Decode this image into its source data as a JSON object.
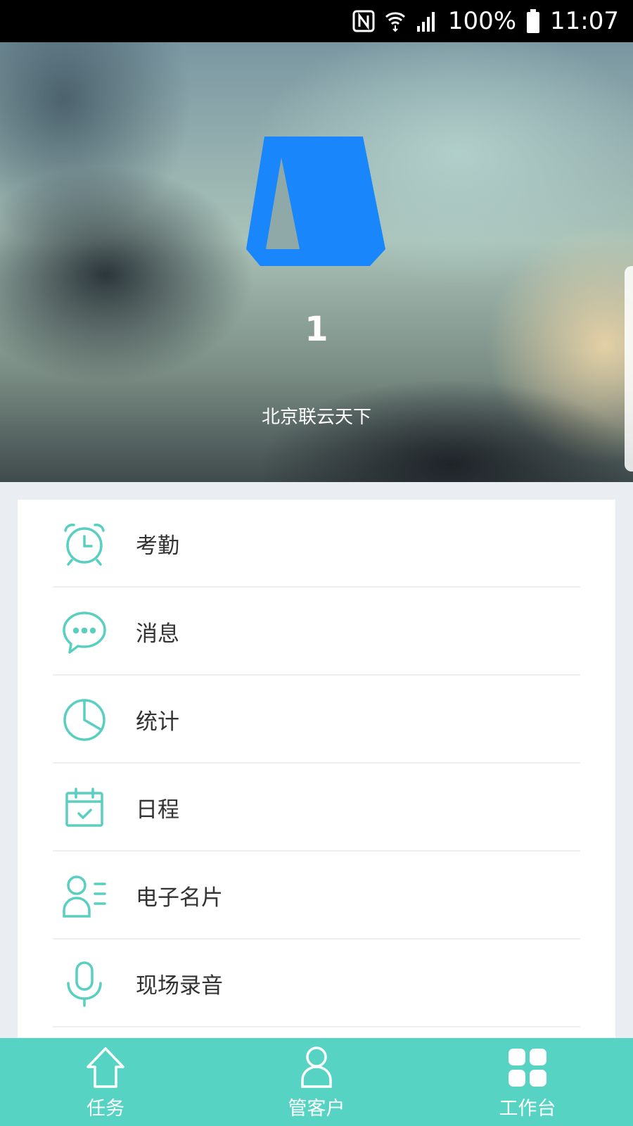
{
  "status_bar": {
    "battery": "100%",
    "time": "11:07",
    "icons": [
      "nfc-icon",
      "wifi-icon",
      "signal-icon",
      "battery-icon"
    ]
  },
  "profile": {
    "number": "1",
    "company": "北京联云天下",
    "logo_color": "#1a86fb"
  },
  "menu": {
    "items": [
      {
        "label": "考勤",
        "icon": "alarm-clock-icon"
      },
      {
        "label": "消息",
        "icon": "chat-bubble-icon"
      },
      {
        "label": "统计",
        "icon": "pie-chart-icon"
      },
      {
        "label": "日程",
        "icon": "calendar-icon"
      },
      {
        "label": "电子名片",
        "icon": "business-card-icon"
      },
      {
        "label": "现场录音",
        "icon": "microphone-icon"
      }
    ]
  },
  "bottom_nav": {
    "tabs": [
      {
        "label": "任务",
        "icon": "home-icon"
      },
      {
        "label": "管客户",
        "icon": "customer-icon"
      },
      {
        "label": "工作台",
        "icon": "grid-icon"
      }
    ]
  },
  "colors": {
    "accent": "#56d3c3",
    "icon_stroke": "#58cfc0",
    "page_background": "#eaedf1"
  }
}
